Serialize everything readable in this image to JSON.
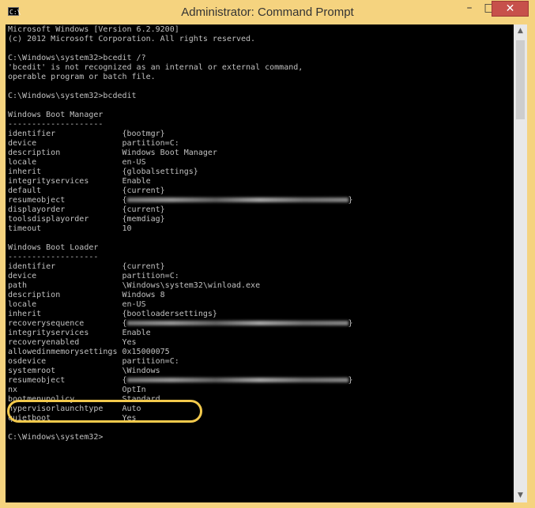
{
  "window": {
    "title": "Administrator: Command Prompt",
    "icon_label": "C:\\",
    "buttons": {
      "minimize": "–",
      "maximize": "□",
      "close": "✕"
    }
  },
  "console": {
    "lines": [
      "Microsoft Windows [Version 6.2.9200]",
      "(c) 2012 Microsoft Corporation. All rights reserved.",
      "",
      "C:\\Windows\\system32>bcedit /?",
      "'bcedit' is not recognized as an internal or external command,",
      "operable program or batch file.",
      "",
      "C:\\Windows\\system32>bcdedit",
      "",
      "Windows Boot Manager",
      "--------------------",
      "identifier              {bootmgr}",
      "device                  partition=C:",
      "description             Windows Boot Manager",
      "locale                  en-US",
      "inherit                 {globalsettings}",
      "integrityservices       Enable",
      "default                 {current}",
      "resumeobject            {",
      "displayorder            {current}",
      "toolsdisplayorder       {memdiag}",
      "timeout                 10",
      "",
      "Windows Boot Loader",
      "-------------------",
      "identifier              {current}",
      "device                  partition=C:",
      "path                    \\Windows\\system32\\winload.exe",
      "description             Windows 8",
      "locale                  en-US",
      "inherit                 {bootloadersettings}",
      "recoverysequence        {",
      "integrityservices       Enable",
      "recoveryenabled         Yes",
      "allowedinmemorysettings 0x15000075",
      "osdevice                partition=C:",
      "systemroot              \\Windows",
      "resumeobject            {",
      "nx                      OptIn",
      "bootmenupolicy          Standard",
      "hypervisorlaunchtype    Auto",
      "quietboot               Yes",
      "",
      "C:\\Windows\\system32>"
    ],
    "blurred_line_indexes": [
      18,
      31,
      37
    ],
    "blurred_suffix": "}"
  },
  "colors": {
    "console_bg": "#000000",
    "console_text": "#c0c0c0",
    "highlight": "#f2c94c",
    "frame": "#f5d37f",
    "close_button": "#c7504b"
  }
}
